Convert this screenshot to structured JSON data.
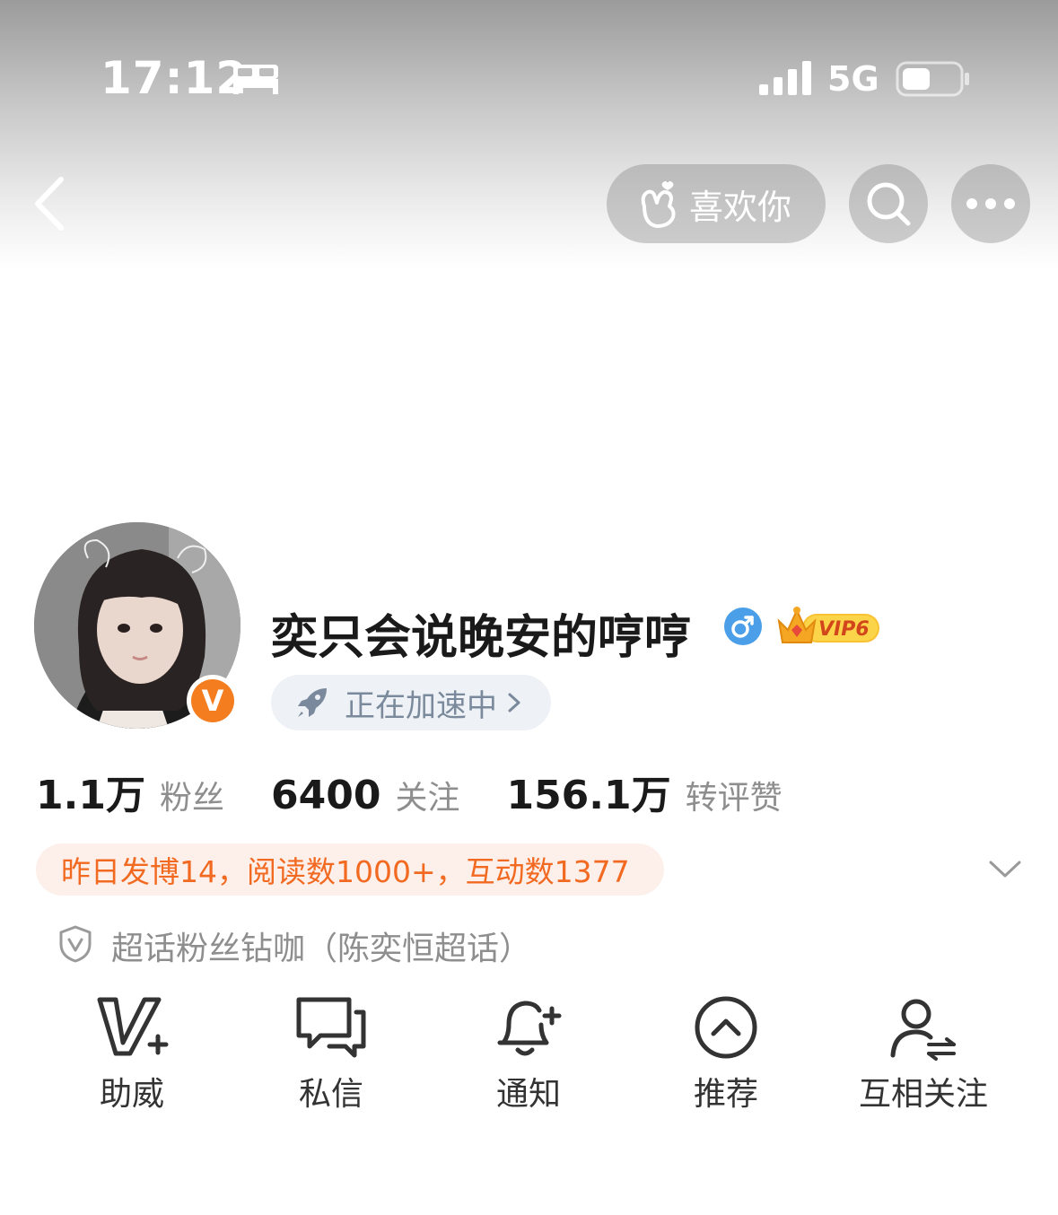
{
  "status_bar": {
    "time": "17:12",
    "network": "5G"
  },
  "nav": {
    "like_label": "喜欢你"
  },
  "profile": {
    "username": "奕只会说晚安的哼哼",
    "vip_text": "VIP6",
    "verified_badge": "V",
    "boost_label": "正在加速中"
  },
  "stats": [
    {
      "value": "1.1万",
      "label": "粉丝"
    },
    {
      "value": "6400",
      "label": "关注"
    },
    {
      "value": "156.1万",
      "label": "转评赞"
    }
  ],
  "activity": {
    "text": "昨日发博14，阅读数1000+，互动数1377"
  },
  "supertopic": {
    "text": "超话粉丝钻咖（陈奕恒超话）"
  },
  "actions": [
    {
      "label": "助威",
      "icon": "cheer-icon"
    },
    {
      "label": "私信",
      "icon": "message-icon"
    },
    {
      "label": "通知",
      "icon": "bell-plus-icon"
    },
    {
      "label": "推荐",
      "icon": "recommend-icon"
    },
    {
      "label": "互相关注",
      "icon": "mutual-follow-icon"
    }
  ],
  "colors": {
    "accent": "#f26a21",
    "verified": "#f47d1f",
    "gender": "#4a9fe8"
  }
}
